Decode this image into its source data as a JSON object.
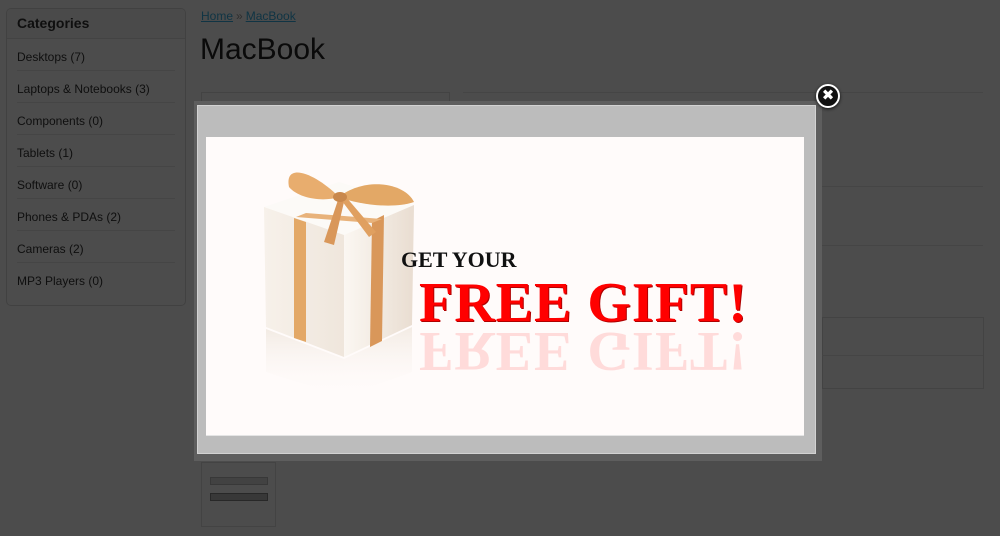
{
  "sidebar": {
    "heading": "Categories",
    "categories": [
      {
        "label": "Desktops (7)"
      },
      {
        "label": "Laptops & Notebooks (3)"
      },
      {
        "label": "Components (0)"
      },
      {
        "label": "Tablets (1)"
      },
      {
        "label": "Software (0)"
      },
      {
        "label": "Phones & PDAs (2)"
      },
      {
        "label": "Cameras (2)"
      },
      {
        "label": "MP3 Players (0)"
      }
    ]
  },
  "breadcrumb": {
    "items": [
      {
        "label": "Home"
      },
      {
        "label": "MacBook"
      }
    ],
    "separator": "»"
  },
  "product": {
    "title": "MacBook"
  },
  "popup": {
    "headline_small": "GET YOUR",
    "headline_big": "FREE GIFT!",
    "close_glyph": "✖",
    "colors": {
      "headline_red": "#ff0000",
      "ribbon": "#e3a866",
      "overlay": "#4c4c4c"
    }
  }
}
